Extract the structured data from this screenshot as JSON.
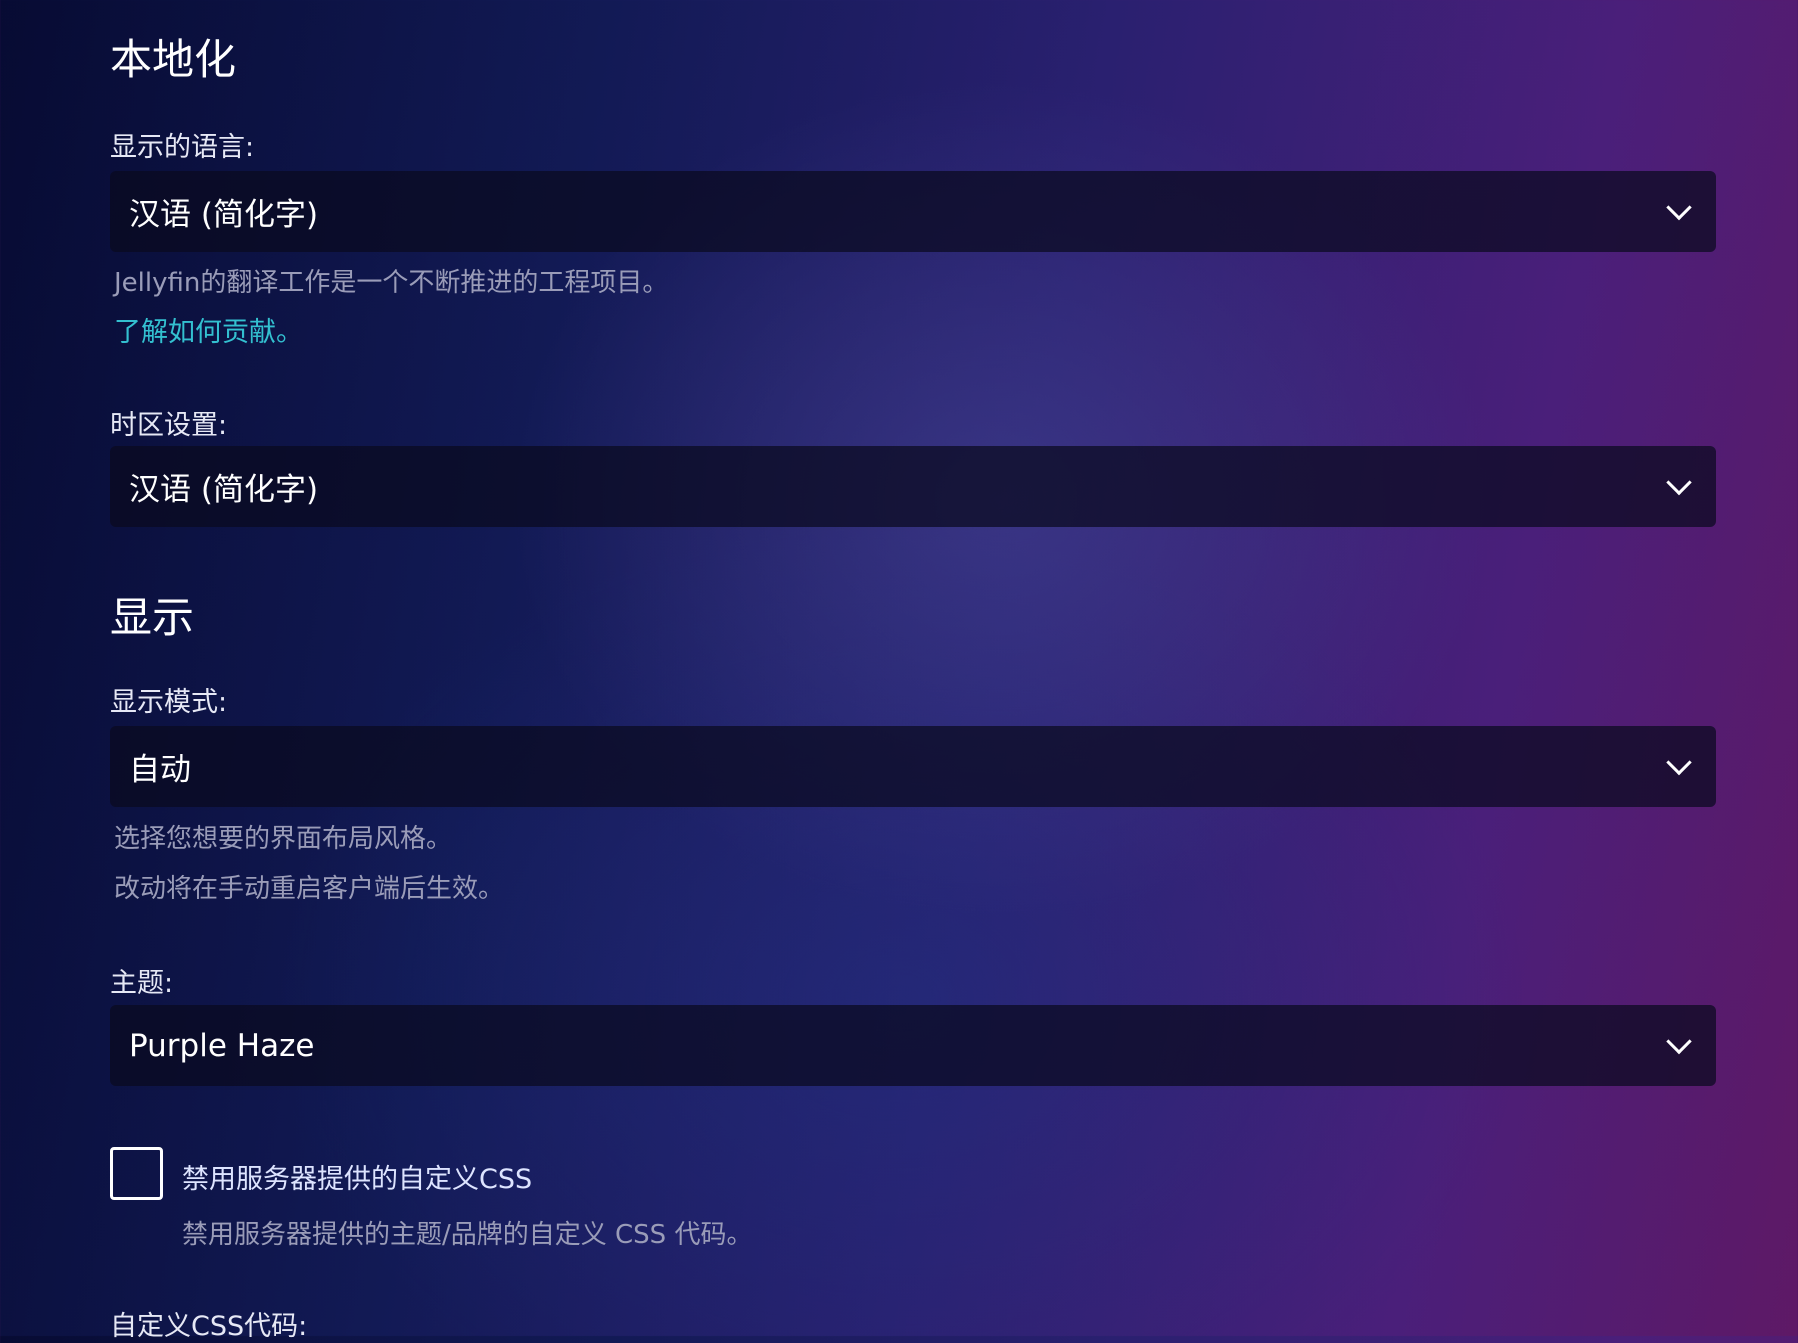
{
  "localization": {
    "heading": "本地化",
    "language": {
      "label": "显示的语言:",
      "value": "汉语 (简化字)",
      "help": "Jellyfin的翻译工作是一个不断推进的工程项目。",
      "link": "了解如何贡献。"
    },
    "timezone": {
      "label": "时区设置:",
      "value": "汉语 (简化字)"
    }
  },
  "display": {
    "heading": "显示",
    "mode": {
      "label": "显示模式:",
      "value": "自动",
      "help1": "选择您想要的界面布局风格。",
      "help2": "改动将在手动重启客户端后生效。"
    },
    "theme": {
      "label": "主题:",
      "value": "Purple Haze"
    },
    "disable_css": {
      "label": "禁用服务器提供的自定义CSS",
      "desc": "禁用服务器提供的主题/品牌的自定义 CSS 代码。",
      "checked": false
    },
    "custom_css": {
      "label": "自定义CSS代码:"
    }
  }
}
